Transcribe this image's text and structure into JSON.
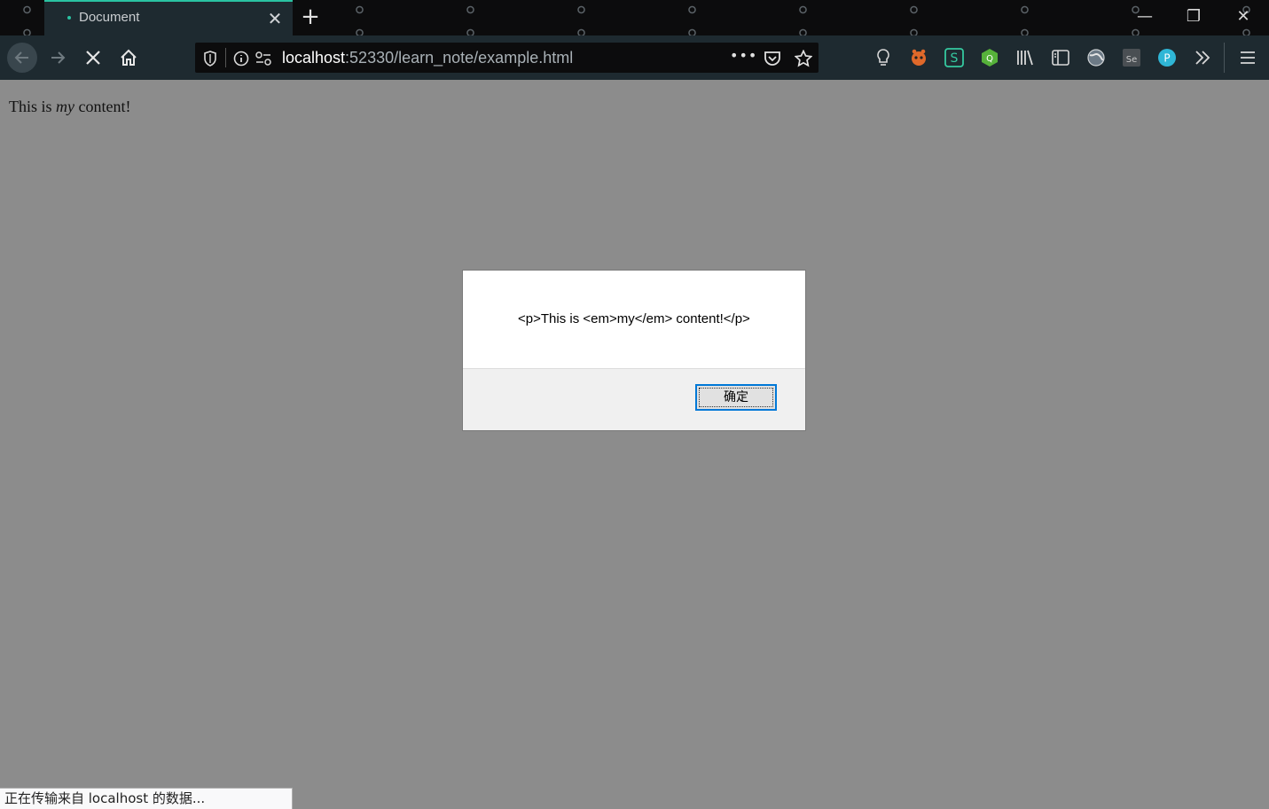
{
  "tab": {
    "title": "Document",
    "close_icon": "close-icon"
  },
  "toolbar": {
    "url_host": "localhost",
    "url_rest": ":52330/learn_note/example.html",
    "more_label": "•••"
  },
  "page": {
    "text_before": "This is ",
    "text_em": "my",
    "text_after": " content!"
  },
  "dialog": {
    "message": "<p>This is <em>my</em> content!</p>",
    "ok_label": "确定"
  },
  "status": {
    "text": "正在传输来自 localhost 的数据..."
  },
  "colors": {
    "accent": "#2ac3a2",
    "toolbar_bg": "#1e2a30",
    "page_bg": "#8c8c8c"
  },
  "extensions": [
    "lightbulb-icon",
    "tampermonkey-icon",
    "s-extension-icon",
    "q-extension-icon",
    "library-icon",
    "sidebar-icon",
    "globe-icon",
    "se-extension-icon",
    "p-profile-icon",
    "overflow-icon",
    "menu-icon"
  ]
}
